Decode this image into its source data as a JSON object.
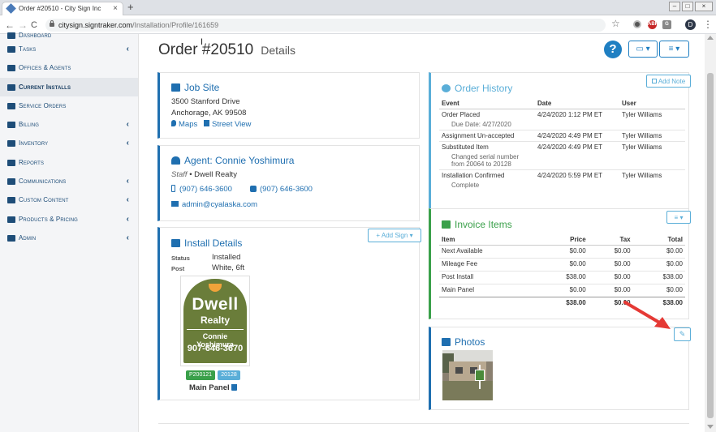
{
  "browser": {
    "tab_title": "Order #20510 - City Sign Inc",
    "tab_close": "×",
    "new_tab": "+",
    "win_min": "–",
    "win_max": "□",
    "win_close": "×",
    "back": "←",
    "forward": "→",
    "reload": "C",
    "url_host": "citysign.signtraker.com",
    "url_path": "/Installation/Profile/161659",
    "star": "☆",
    "ext_abp": "ABP",
    "ext_g": "G",
    "profile_initial": "D",
    "menu": "⋮"
  },
  "sidebar": {
    "items": [
      {
        "label": "Dashboard",
        "chevron": ""
      },
      {
        "label": "Tasks",
        "chevron": "‹"
      },
      {
        "label": "Offices & Agents",
        "chevron": ""
      },
      {
        "label": "Current Installs",
        "chevron": "",
        "active": true
      },
      {
        "label": "Service Orders",
        "chevron": ""
      },
      {
        "label": "Billing",
        "chevron": "‹"
      },
      {
        "label": "Inventory",
        "chevron": "‹"
      },
      {
        "label": "Reports",
        "chevron": ""
      },
      {
        "label": "Communications",
        "chevron": "‹"
      },
      {
        "label": "Custom Content",
        "chevron": "‹"
      },
      {
        "label": "Products & Pricing",
        "chevron": "‹"
      },
      {
        "label": "Admin",
        "chevron": "‹"
      }
    ]
  },
  "header": {
    "title": "Order #20510",
    "subtitle": "Details",
    "help": "?",
    "print_icon": "▭",
    "caret": "▾",
    "menu_icon": "≡",
    "cursor": "I"
  },
  "job_site": {
    "title": "Job Site",
    "address1": "3500 Stanford Drive",
    "address2": "Anchorage, AK 99508",
    "maps": "Maps",
    "street_view": "Street View"
  },
  "agent": {
    "prefix": "Agent:",
    "name": "Connie Yoshimura",
    "role": "Staff",
    "sep": "•",
    "company": "Dwell Realty",
    "phone1": "(907) 646-3600",
    "phone2": "(907) 646-3600",
    "email": "admin@cyalaska.com"
  },
  "install": {
    "title": "Install Details",
    "add_sign": "+ Add Sign",
    "status_label": "Status",
    "status_value": "Installed",
    "post_label": "Post",
    "post_value": "White, 6ft",
    "badge1": "P200121",
    "badge2": "20128",
    "sign_name": "Main Panel",
    "sign_text": {
      "line1": "Dwell",
      "line2": "Realty",
      "line3": "Connie Yoshimura",
      "line4": "907-646-3670"
    },
    "colors": {
      "badge1": "#3aa04a",
      "badge2": "#5aaed8",
      "sign": "#6a7d3a"
    }
  },
  "order_history": {
    "title": "Order History",
    "add_note": "Add Note",
    "columns": [
      "Event",
      "Date",
      "User"
    ],
    "rows": [
      {
        "event": "Order Placed",
        "note": "Due Date: 4/27/2020",
        "date": "4/24/2020 1:12 PM ET",
        "user": "Tyler Williams"
      },
      {
        "event": "Assignment Un-accepted",
        "note": "",
        "date": "4/24/2020 4:49 PM ET",
        "user": "Tyler Williams"
      },
      {
        "event": "Substituted Item",
        "note": "Changed serial number from 20064 to 20128",
        "date": "4/24/2020 4:49 PM ET",
        "user": "Tyler Williams"
      },
      {
        "event": "Installation Confirmed",
        "note": "Complete",
        "date": "4/24/2020 5:59 PM ET",
        "user": "Tyler Williams"
      }
    ]
  },
  "invoice": {
    "title": "Invoice Items",
    "columns": [
      "Item",
      "Price",
      "Tax",
      "Total"
    ],
    "rows": [
      {
        "item": "Next Available",
        "price": "$0.00",
        "tax": "$0.00",
        "total": "$0.00"
      },
      {
        "item": "Mileage Fee",
        "price": "$0.00",
        "tax": "$0.00",
        "total": "$0.00"
      },
      {
        "item": "Post Install",
        "price": "$38.00",
        "tax": "$0.00",
        "total": "$38.00"
      },
      {
        "item": "Main Panel",
        "price": "$0.00",
        "tax": "$0.00",
        "total": "$0.00"
      }
    ],
    "totals": {
      "price": "$38.00",
      "tax": "$0.00",
      "total": "$38.00"
    }
  },
  "photos": {
    "title": "Photos",
    "edit_icon": "✎"
  },
  "colors": {
    "accent": "#1f7fc2",
    "green": "#3aa04a",
    "light_blue": "#5aaed8",
    "annotation_arrow": "#e53935"
  }
}
